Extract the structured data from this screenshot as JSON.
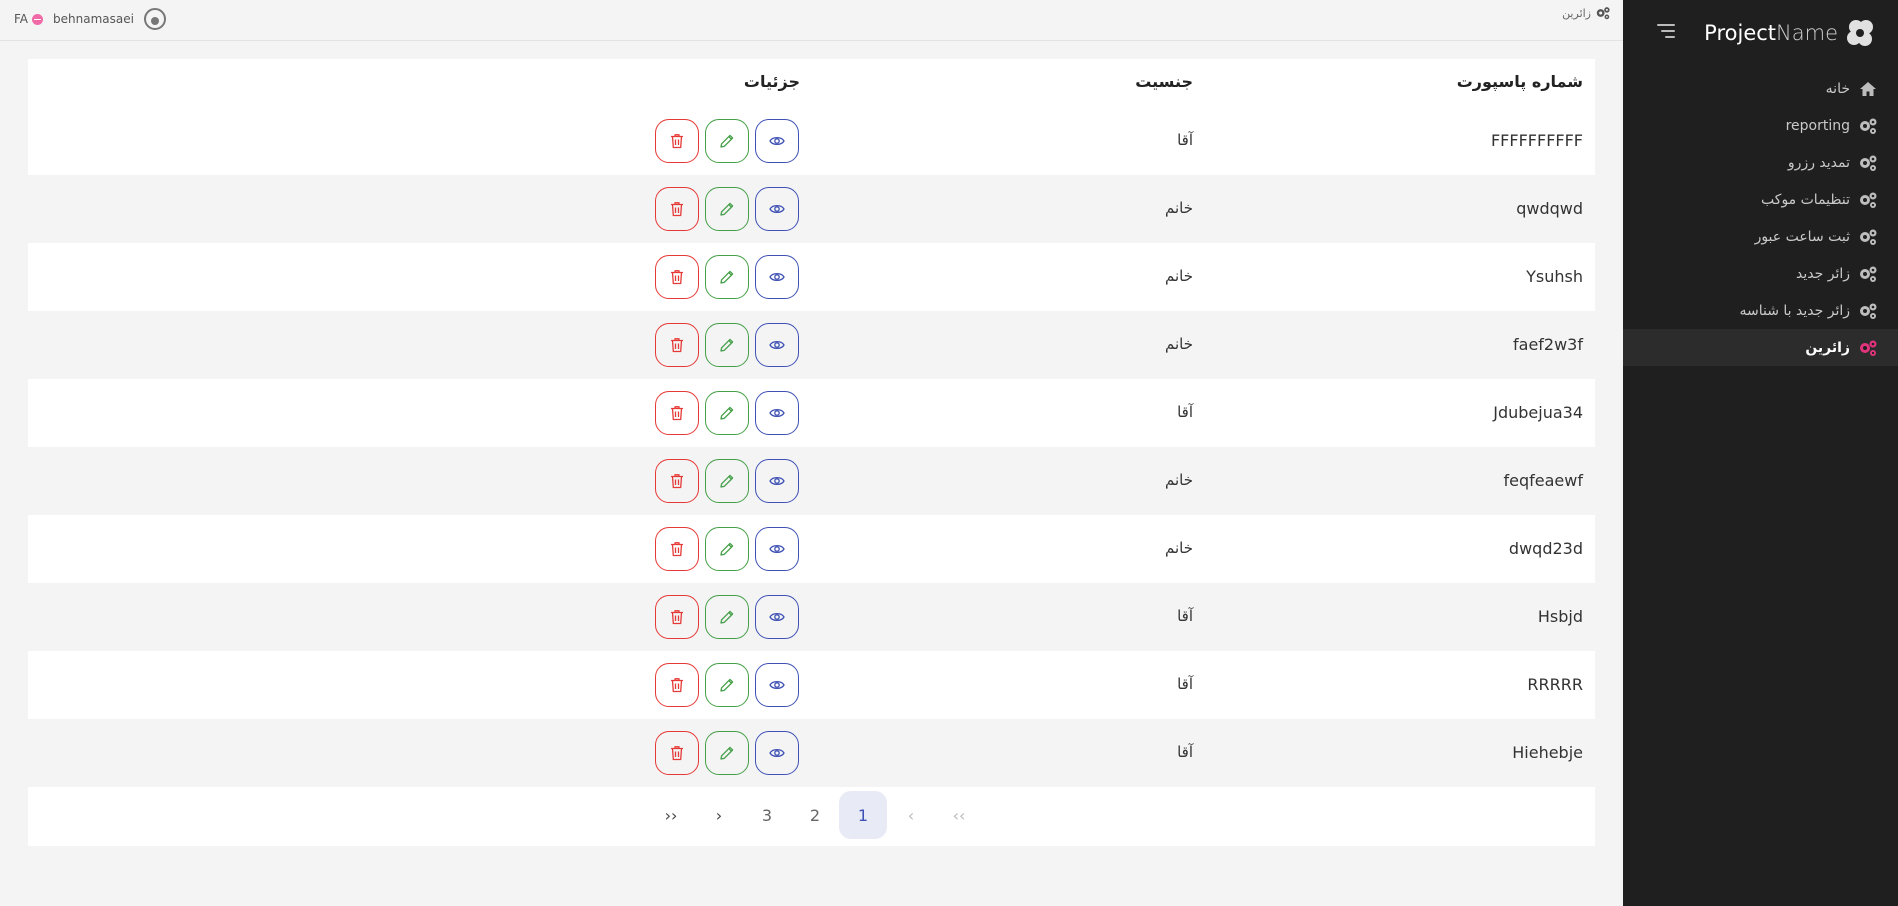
{
  "sidebar": {
    "brand": {
      "bold": "Project",
      "light": "Name"
    },
    "items": [
      {
        "label": "خانه",
        "icon": "home-icon",
        "active": false
      },
      {
        "label": "reporting",
        "icon": "gears-icon",
        "active": false
      },
      {
        "label": "تمدید رزرو",
        "icon": "gears-icon",
        "active": false
      },
      {
        "label": "تنظیمات موکب",
        "icon": "gears-icon",
        "active": false
      },
      {
        "label": "ثبت ساعت عبور",
        "icon": "gears-icon",
        "active": false
      },
      {
        "label": "زائر جدید",
        "icon": "gears-icon",
        "active": false
      },
      {
        "label": "زائر جدید با شناسه",
        "icon": "gears-icon",
        "active": false
      },
      {
        "label": "زائرین",
        "icon": "gears-icon",
        "active": true
      }
    ]
  },
  "topbar": {
    "breadcrumb": "زائرین",
    "username": "behnamasaei",
    "language": "FA"
  },
  "table": {
    "headers": {
      "passport": "شماره پاسپورت",
      "gender": "جنسیت",
      "details": "جزئیات"
    },
    "rows": [
      {
        "passport": "FFFFFFFFFF",
        "gender": "آقا"
      },
      {
        "passport": "qwdqwd",
        "gender": "خانم"
      },
      {
        "passport": "Ysuhsh",
        "gender": "خانم"
      },
      {
        "passport": "faef2w3f",
        "gender": "خانم"
      },
      {
        "passport": "Jdubejua34",
        "gender": "آقا"
      },
      {
        "passport": "feqfeaewf",
        "gender": "خانم"
      },
      {
        "passport": "dwqd23d",
        "gender": "خانم"
      },
      {
        "passport": "Hsbjd",
        "gender": "آقا"
      },
      {
        "passport": "RRRRR",
        "gender": "آقا"
      },
      {
        "passport": "Hiehebje",
        "gender": "آقا"
      }
    ]
  },
  "pagination": {
    "last": "››",
    "next": "›",
    "pages": [
      "3",
      "2",
      "1"
    ],
    "current": "1",
    "prev": "‹",
    "first": "‹‹"
  },
  "colors": {
    "sidebar_bg": "#1f1f1f",
    "accent": "#e2347d",
    "view": "#3f51b5",
    "edit": "#43a047",
    "delete": "#e53935"
  }
}
